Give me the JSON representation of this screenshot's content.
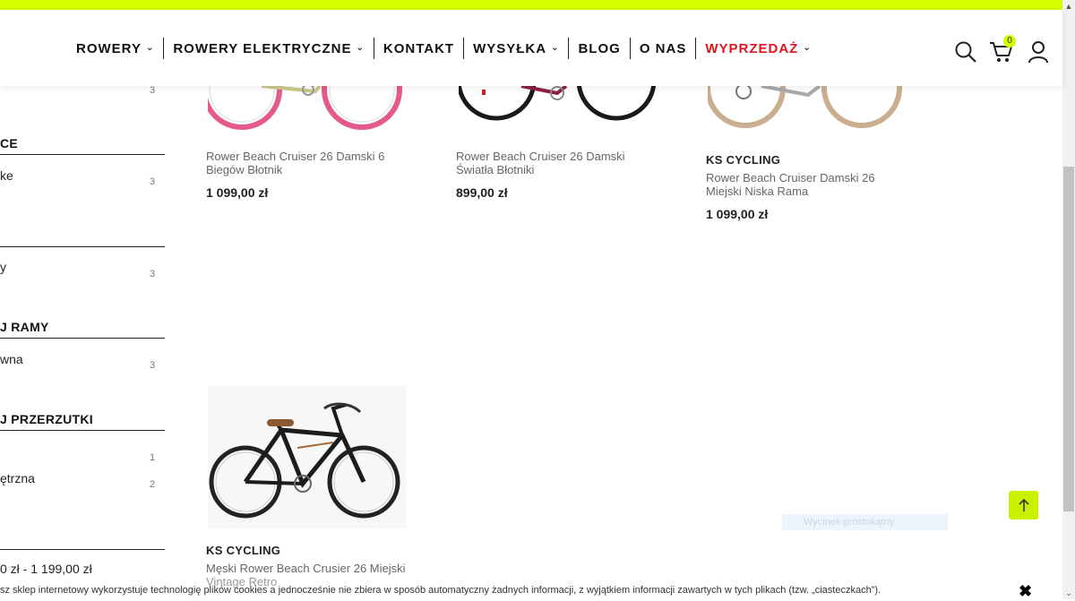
{
  "header": {
    "nav": [
      {
        "label": "ROWERY",
        "dropdown": true
      },
      {
        "label": "ROWERY ELEKTRYCZNE",
        "dropdown": true
      },
      {
        "label": "KONTAKT",
        "dropdown": false
      },
      {
        "label": "WYSYŁKA",
        "dropdown": true
      },
      {
        "label": "BLOG",
        "dropdown": false
      },
      {
        "label": "O NAS",
        "dropdown": false
      },
      {
        "label": "WYPRZEDAŻ",
        "dropdown": true,
        "color": "#e0141e"
      }
    ],
    "cart_count": "0",
    "icons": [
      "search-icon",
      "cart-icon",
      "user-icon"
    ]
  },
  "sidebar": {
    "count_top": "3",
    "sections": [
      {
        "title": "CE",
        "items": [
          {
            "label": "ke",
            "count": "3"
          }
        ]
      },
      {
        "title": "",
        "items": [
          {
            "label": "y",
            "count": "3"
          }
        ]
      },
      {
        "title": "J RAMY",
        "items": [
          {
            "label": "wna",
            "count": "3"
          }
        ]
      },
      {
        "title": "J PRZERZUTKI",
        "items": [
          {
            "label": "",
            "count": "1"
          },
          {
            "label": "ętrzna",
            "count": "2"
          }
        ]
      },
      {
        "title": "",
        "items": [
          {
            "label": "0 zł - 1 199,00 zł",
            "count": ""
          }
        ]
      }
    ]
  },
  "products": [
    {
      "brand": "",
      "name": "Rower Beach Cruiser 26 Damski 6 Biegów Błotnik",
      "price": "1 099,00 zł"
    },
    {
      "brand": "",
      "name": "Rower Beach Cruiser 26 Damski Światła Błotniki",
      "price": "899,00 zł"
    },
    {
      "brand": "KS CYCLING",
      "name": "Rower Beach Cruiser Damski 26 Miejski Niska Rama",
      "price": "1 099,00 zł"
    },
    {
      "brand": "KS CYCLING",
      "name": "Męski Rower Beach Crusier 26 Miejski",
      "name2": "Vintage Retro",
      "price": ""
    }
  ],
  "faint_badge": "Wycinek prostokątny",
  "cookie": {
    "text": "sz sklep internetowy wykorzystuje technologię plików cookies a jednocześnie nie zbiera w sposób automatyczny żadnych informacji, z wyjątkiem informacji zawartych w tych plikach (tzw. „ciasteczkach”).",
    "close": "✖"
  },
  "colors": {
    "accent": "#d4ff00",
    "sale": "#e0141e"
  }
}
